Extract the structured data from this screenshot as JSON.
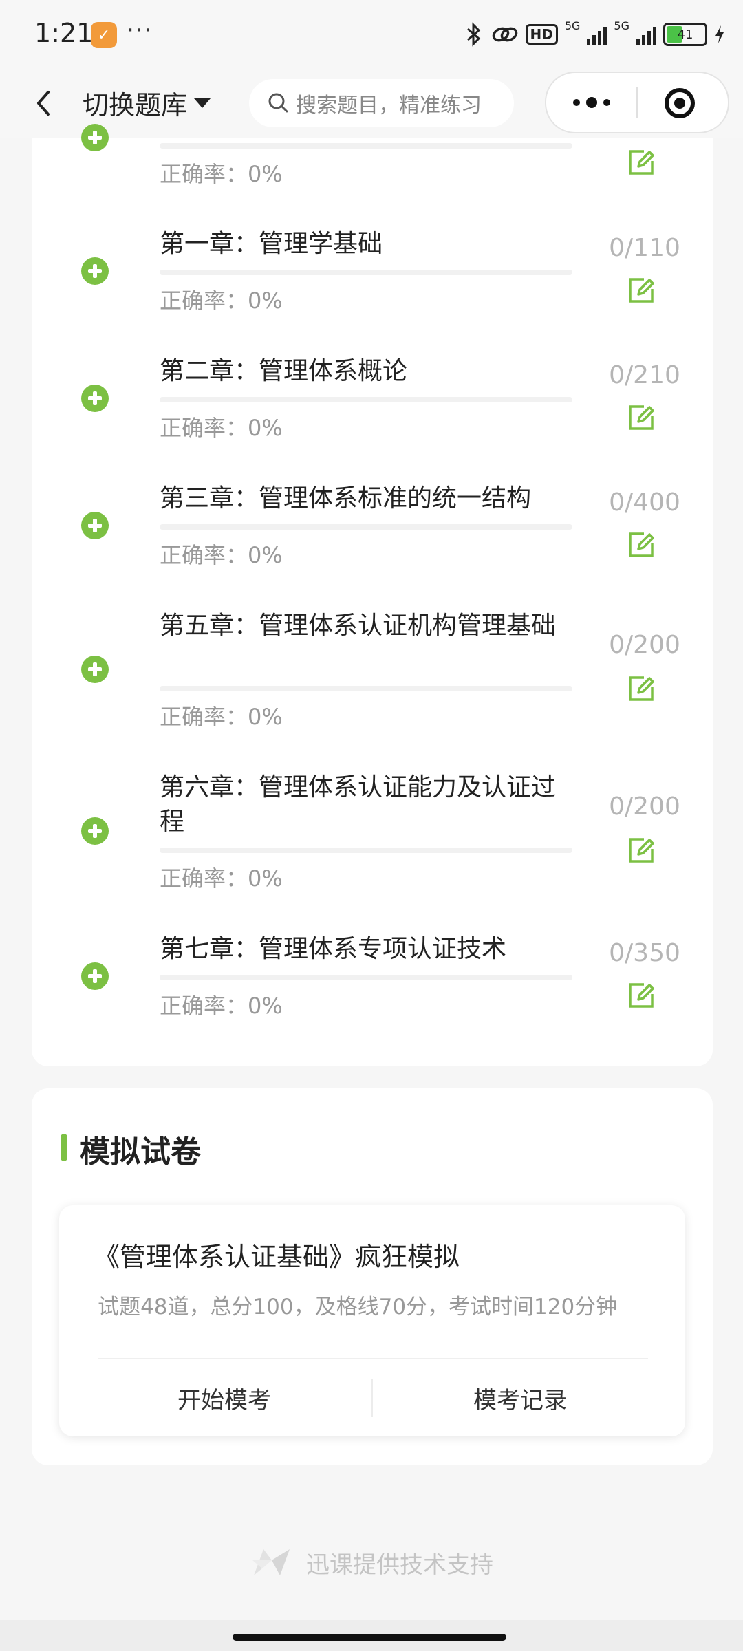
{
  "status_bar": {
    "time": "1:21",
    "app_badge": "✓",
    "more": "···",
    "hd_label": "HD",
    "net1": "5G",
    "net2": "5G",
    "battery": "41"
  },
  "nav": {
    "title": "切换题库",
    "search_placeholder": "搜索题目，精准练习"
  },
  "chapters": [
    {
      "title": "",
      "rate": "正确率：0%",
      "count": ""
    },
    {
      "title": "第一章：管理学基础",
      "rate": "正确率：0%",
      "count": "0/110"
    },
    {
      "title": "第二章：管理体系概论",
      "rate": "正确率：0%",
      "count": "0/210"
    },
    {
      "title": "第三章：管理体系标准的统一结构",
      "rate": "正确率：0%",
      "count": "0/400"
    },
    {
      "title": "第五章：管理体系认证机构管理基础",
      "rate": "正确率：0%",
      "count": "0/200"
    },
    {
      "title": "第六章：管理体系认证能力及认证过程",
      "rate": "正确率：0%",
      "count": "0/200"
    },
    {
      "title": "第七章：管理体系专项认证技术",
      "rate": "正确率：0%",
      "count": "0/350"
    }
  ],
  "mock": {
    "section_title": "模拟试卷",
    "exam_title": "《管理体系认证基础》疯狂模拟",
    "exam_desc": "试题48道，总分100，及格线70分，考试时间120分钟",
    "start_label": "开始模考",
    "record_label": "模考记录"
  },
  "footer": {
    "text": "迅课提供技术支持"
  },
  "colors": {
    "accent": "#7cc043",
    "count_gray": "#b5b5b5",
    "rate_gray": "#999999"
  }
}
